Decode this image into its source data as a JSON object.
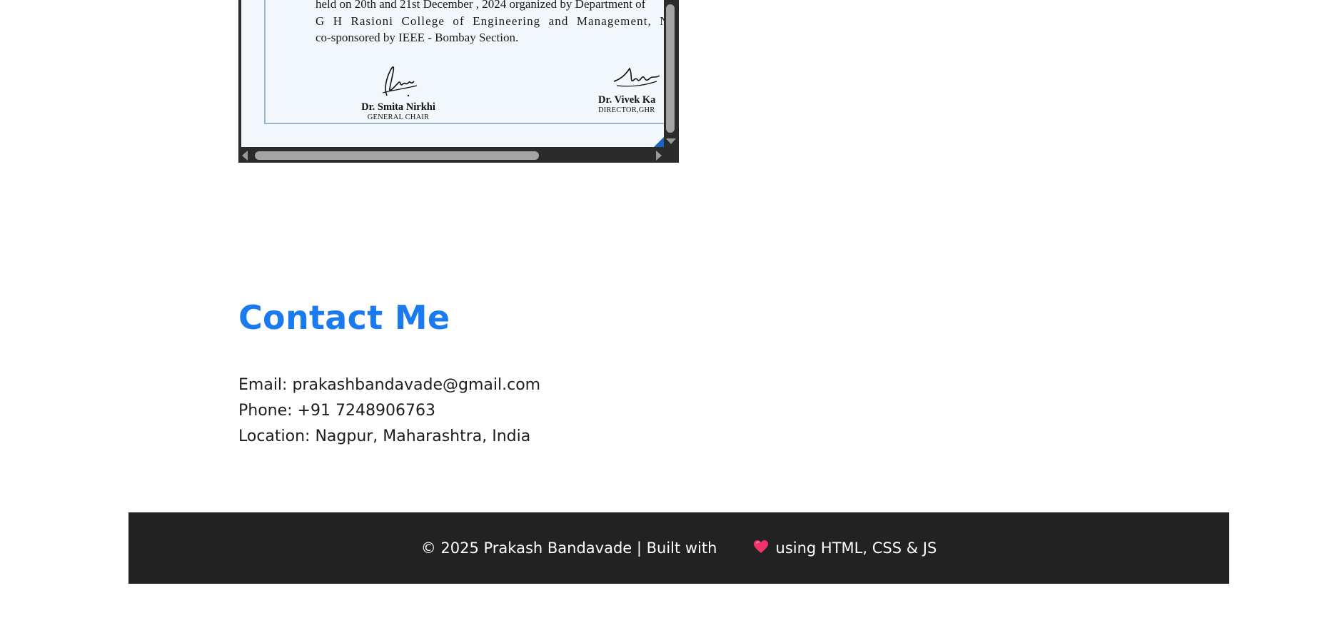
{
  "certificate": {
    "body_lines": [
      "held on 20th and 21st December , 2024 organized by Department of",
      "G H Rasioni College of Engineering and Management, Nag",
      "co-sponsored by IEEE - Bombay Section."
    ],
    "signatories": [
      {
        "name": "Dr. Smita Nirkhi",
        "role": "GENERAL CHAIR"
      },
      {
        "name": "Dr. Vivek Ka",
        "role": "DIRECTOR,GHR"
      }
    ]
  },
  "contact": {
    "title": "Contact Me",
    "email_line": "Email: prakashbandavade@gmail.com",
    "phone_line": "Phone: +91 7248906763",
    "location_line": "Location: Nagpur, Maharashtra, India"
  },
  "footer": {
    "text_before": "© 2025 Prakash Bandavade | Built with",
    "icon": "heart-icon",
    "text_after": "using HTML, CSS & JS"
  },
  "colors": {
    "accent": "#1a7bf0",
    "footer_bg": "#222222",
    "heart": "#f0346b"
  }
}
